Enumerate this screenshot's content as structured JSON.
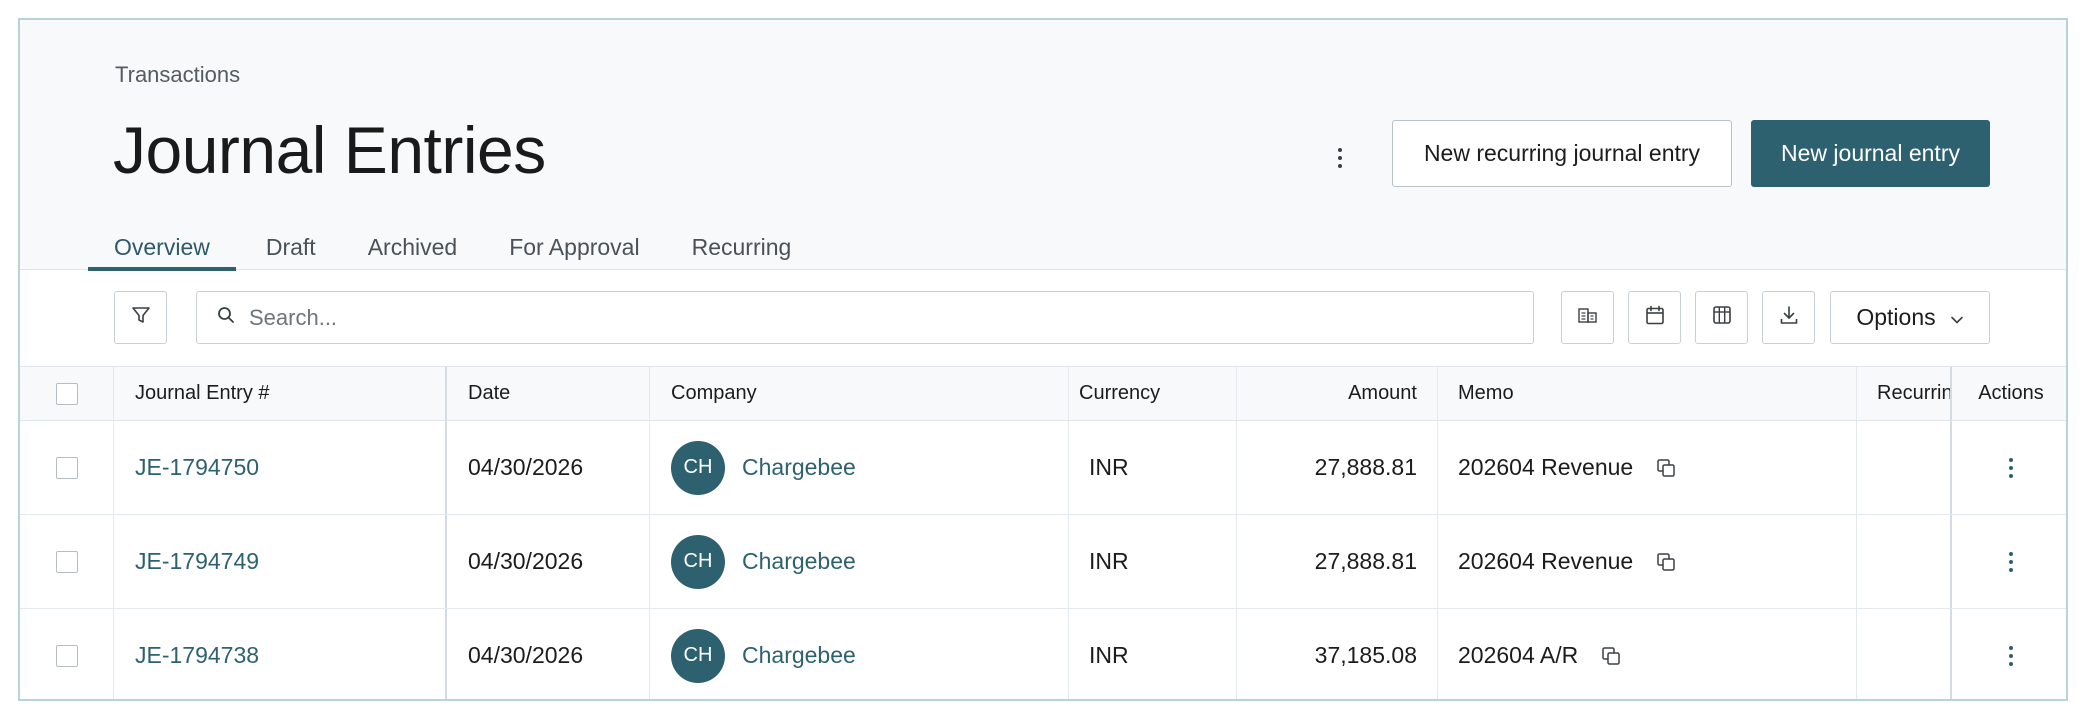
{
  "header": {
    "breadcrumb": "Transactions",
    "title": "Journal Entries",
    "new_recurring_label": "New recurring journal entry",
    "new_entry_label": "New journal entry"
  },
  "tabs": [
    {
      "label": "Overview",
      "active": true
    },
    {
      "label": "Draft"
    },
    {
      "label": "Archived"
    },
    {
      "label": "For Approval"
    },
    {
      "label": "Recurring"
    }
  ],
  "toolbar": {
    "search_placeholder": "Search...",
    "options_label": "Options",
    "icons": [
      "filter-icon",
      "search-icon",
      "company-icon",
      "calendar-icon",
      "columns-icon",
      "download-icon",
      "chevron-down-icon"
    ]
  },
  "table": {
    "columns": {
      "je": "Journal Entry #",
      "date": "Date",
      "company": "Company",
      "currency": "Currency",
      "amount": "Amount",
      "memo": "Memo",
      "recurring": "Recurring",
      "actions": "Actions"
    },
    "rows": [
      {
        "je": "JE-1794750",
        "date": "04/30/2026",
        "avatar": "CH",
        "company": "Chargebee",
        "currency": "INR",
        "amount": "27,888.81",
        "memo": "202604 Revenue"
      },
      {
        "je": "JE-1794749",
        "date": "04/30/2026",
        "avatar": "CH",
        "company": "Chargebee",
        "currency": "INR",
        "amount": "27,888.81",
        "memo": "202604 Revenue"
      },
      {
        "je": "JE-1794738",
        "date": "04/30/2026",
        "avatar": "CH",
        "company": "Chargebee",
        "currency": "INR",
        "amount": "37,185.08",
        "memo": "202604 A/R"
      }
    ]
  },
  "colors": {
    "accent": "#2e6170",
    "header_bg": "#f7f9fb",
    "border": "#dfe5ea"
  }
}
